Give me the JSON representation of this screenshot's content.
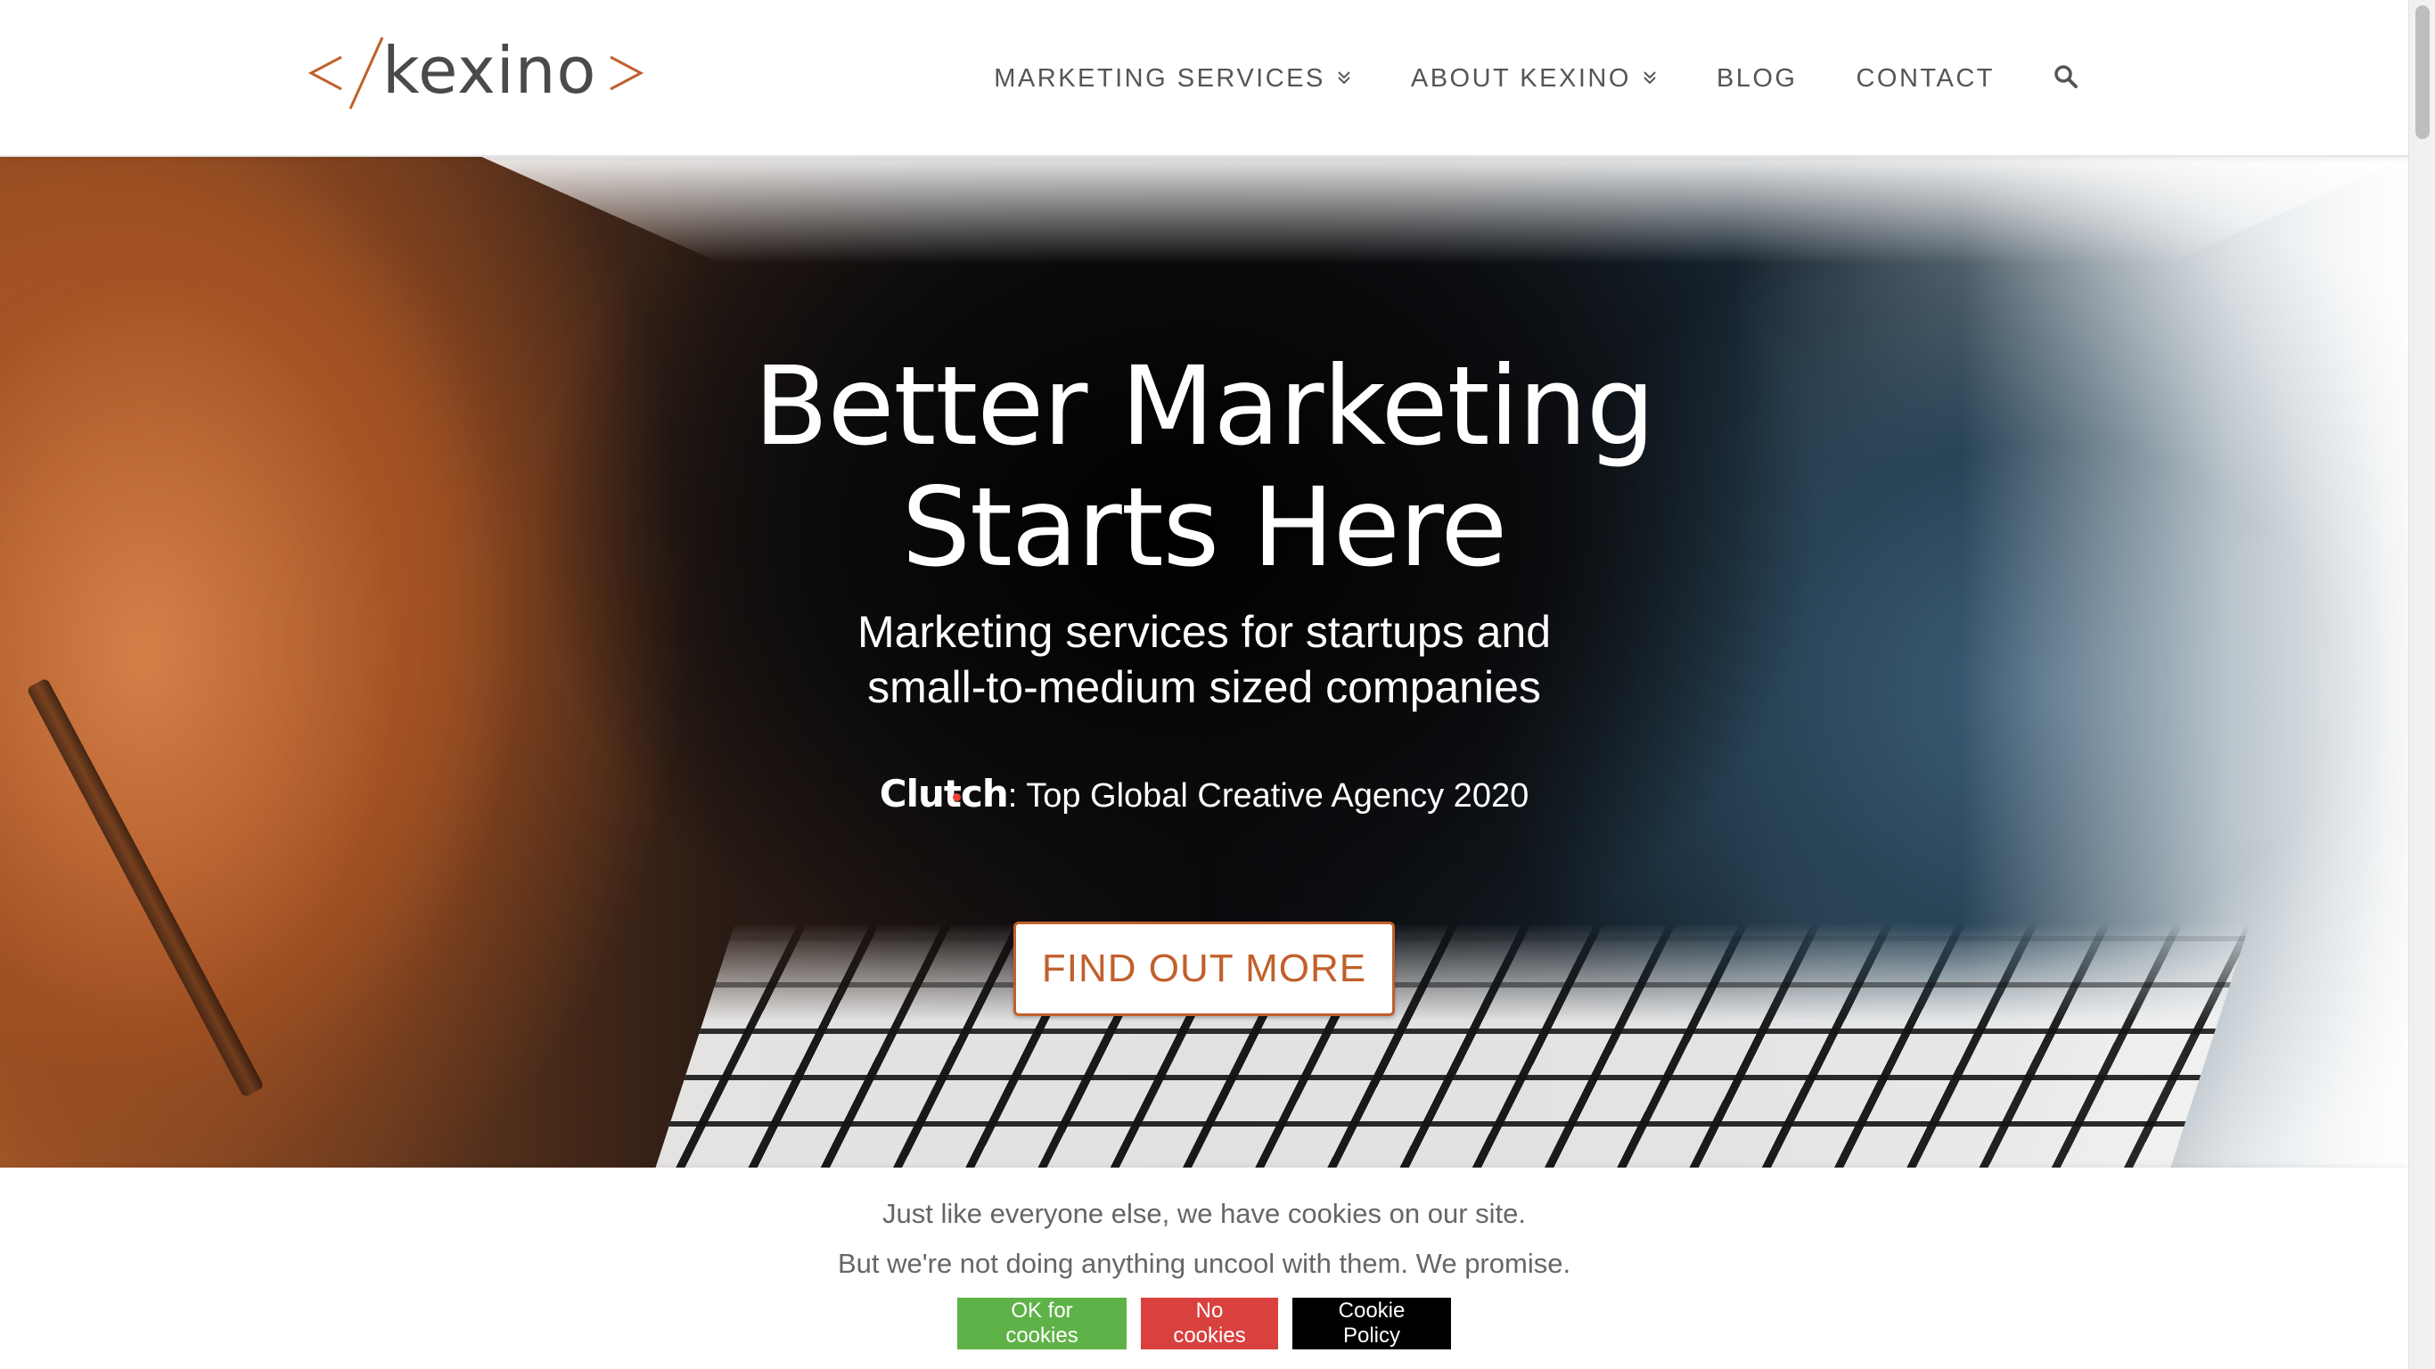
{
  "brand": {
    "logo_text": "kexino",
    "accent_color": "#c1602c"
  },
  "nav": {
    "items": [
      {
        "label": "MARKETING SERVICES",
        "has_dropdown": true
      },
      {
        "label": "ABOUT KEXINO",
        "has_dropdown": true
      },
      {
        "label": "BLOG",
        "has_dropdown": false
      },
      {
        "label": "CONTACT",
        "has_dropdown": false
      }
    ],
    "search_icon": "search-icon"
  },
  "hero": {
    "title_line1": "Better Marketing",
    "title_line2": "Starts Here",
    "subtitle_line1": "Marketing services for startups and",
    "subtitle_line2": "small-to-medium sized companies",
    "award_logo": "Clutch",
    "award_text": ": Top Global Creative Agency 2020",
    "cta_label": "FIND OUT MORE"
  },
  "cookie_bar": {
    "line1": "Just like everyone else, we have cookies on our site.",
    "line2": "But we're not doing anything uncool with them. We promise.",
    "ok_label": "OK for cookies",
    "no_label": "No cookies",
    "policy_label": "Cookie Policy",
    "ok_color": "#5fb247",
    "no_color": "#d8413d",
    "policy_color": "#000000"
  }
}
